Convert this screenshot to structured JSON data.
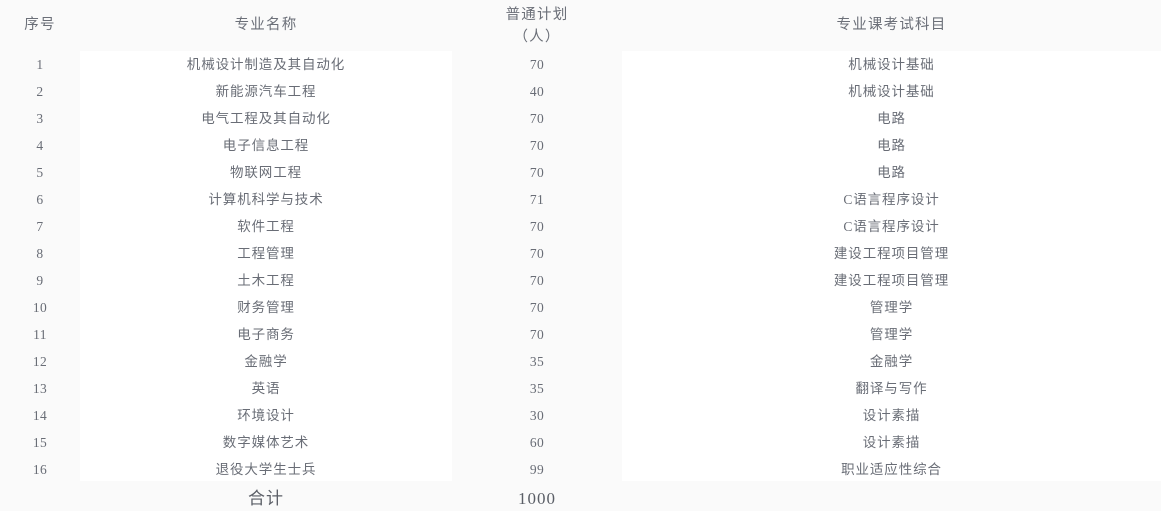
{
  "table": {
    "headers": [
      {
        "label": "序号",
        "key": "seq"
      },
      {
        "label": "专业名称",
        "key": "major"
      },
      {
        "label_line1": "普通计划",
        "label_line2": "（人）",
        "key": "quota"
      },
      {
        "label": "专业课考试科目",
        "key": "subject"
      }
    ],
    "rows": [
      {
        "seq": "1",
        "major": "机械设计制造及其自动化",
        "quota": "70",
        "subject": "机械设计基础"
      },
      {
        "seq": "2",
        "major": "新能源汽车工程",
        "quota": "40",
        "subject": "机械设计基础"
      },
      {
        "seq": "3",
        "major": "电气工程及其自动化",
        "quota": "70",
        "subject": "电路"
      },
      {
        "seq": "4",
        "major": "电子信息工程",
        "quota": "70",
        "subject": "电路"
      },
      {
        "seq": "5",
        "major": "物联网工程",
        "quota": "70",
        "subject": "电路"
      },
      {
        "seq": "6",
        "major": "计算机科学与技术",
        "quota": "71",
        "subject": "C语言程序设计"
      },
      {
        "seq": "7",
        "major": "软件工程",
        "quota": "70",
        "subject": "C语言程序设计"
      },
      {
        "seq": "8",
        "major": "工程管理",
        "quota": "70",
        "subject": "建设工程项目管理"
      },
      {
        "seq": "9",
        "major": "土木工程",
        "quota": "70",
        "subject": "建设工程项目管理"
      },
      {
        "seq": "10",
        "major": "财务管理",
        "quota": "70",
        "subject": "管理学"
      },
      {
        "seq": "11",
        "major": "电子商务",
        "quota": "70",
        "subject": "管理学"
      },
      {
        "seq": "12",
        "major": "金融学",
        "quota": "35",
        "subject": "金融学"
      },
      {
        "seq": "13",
        "major": "英语",
        "quota": "35",
        "subject": "翻译与写作"
      },
      {
        "seq": "14",
        "major": "环境设计",
        "quota": "30",
        "subject": "设计素描"
      },
      {
        "seq": "15",
        "major": "数字媒体艺术",
        "quota": "60",
        "subject": "设计素描"
      },
      {
        "seq": "16",
        "major": "退役大学生士兵",
        "quota": "99",
        "subject": "职业适应性综合"
      }
    ],
    "total": {
      "label": "合计",
      "value": "1000"
    }
  },
  "colors": {
    "page_background": "#fafafa",
    "column_background": "#ffffff",
    "text": "#696d76",
    "header_text": "#6b6f78",
    "total_text": "#5a5e66"
  }
}
